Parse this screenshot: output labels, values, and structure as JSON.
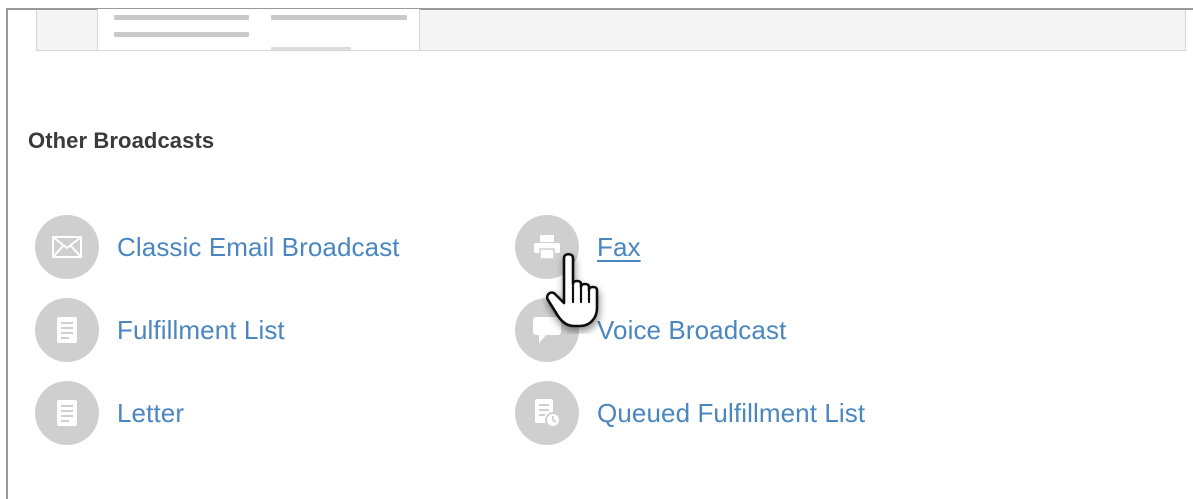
{
  "section": {
    "title": "Other Broadcasts"
  },
  "items": [
    {
      "label": "Classic Email Broadcast",
      "icon": "envelope-icon",
      "hovered": false
    },
    {
      "label": "Fax",
      "icon": "printer-icon",
      "hovered": true
    },
    {
      "label": "Fulfillment List",
      "icon": "document-icon",
      "hovered": false
    },
    {
      "label": "Voice Broadcast",
      "icon": "speech-bubble-icon",
      "hovered": false
    },
    {
      "label": "Letter",
      "icon": "document-icon",
      "hovered": false
    },
    {
      "label": "Queued Fulfillment List",
      "icon": "queued-document-icon",
      "hovered": false
    }
  ],
  "colors": {
    "link": "#4a86bf",
    "icon_circle": "#cfcfcf",
    "heading": "#3b3b3b"
  }
}
